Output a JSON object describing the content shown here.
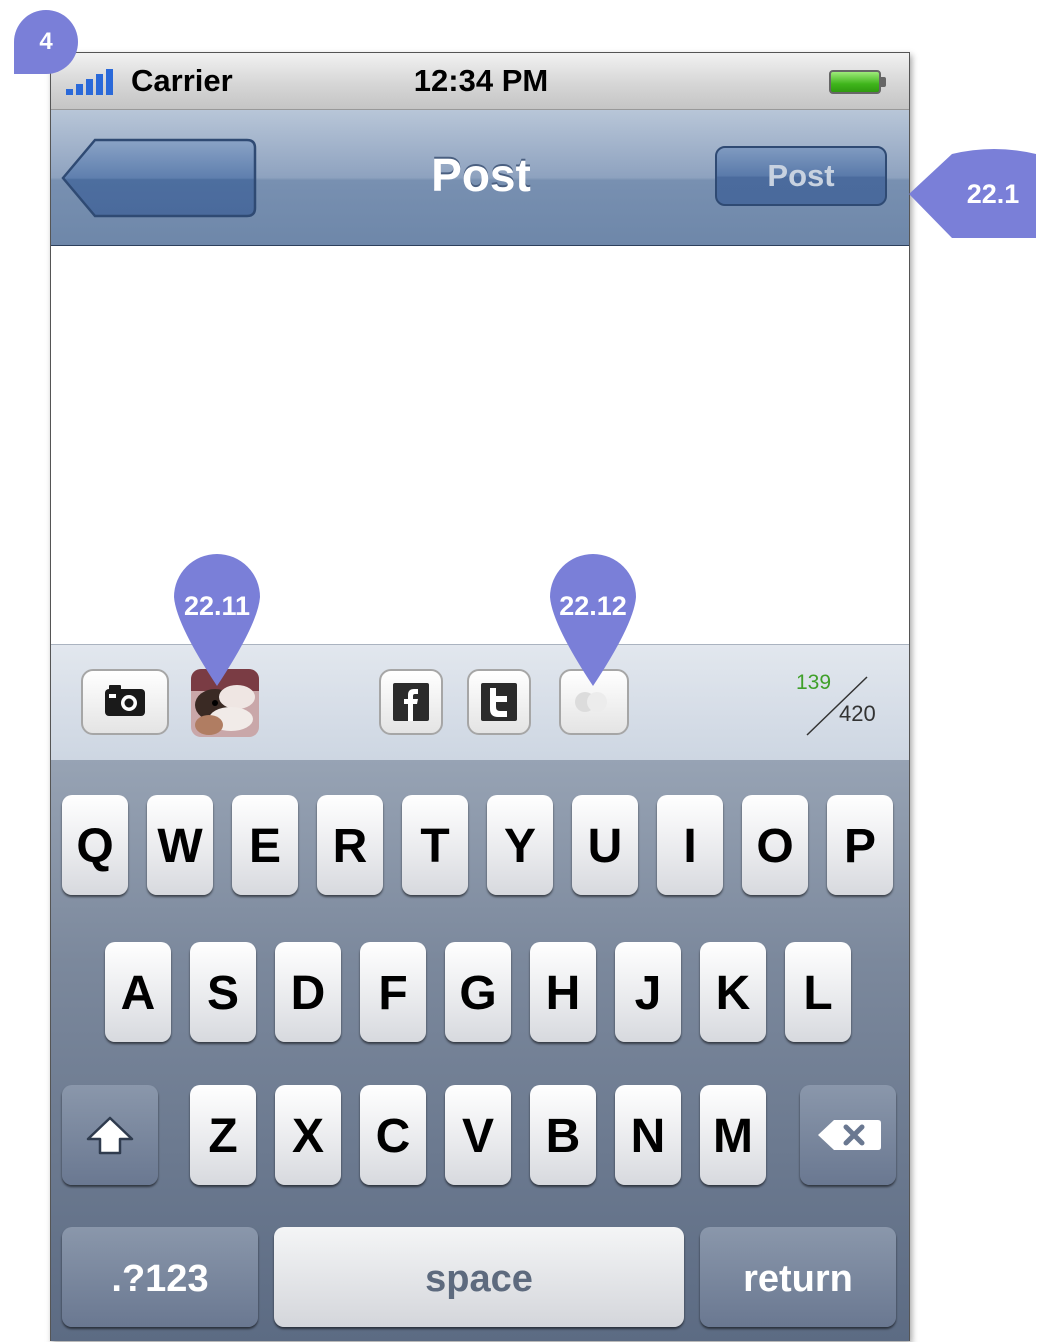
{
  "status_bar": {
    "carrier": "Carrier",
    "time": "12:34 PM"
  },
  "nav_bar": {
    "title": "Post",
    "post_button_label": "Post"
  },
  "toolbar": {
    "chars_used": "139",
    "chars_total": "420"
  },
  "keyboard": {
    "row1": [
      "Q",
      "W",
      "E",
      "R",
      "T",
      "Y",
      "U",
      "I",
      "O",
      "P"
    ],
    "row2": [
      "A",
      "S",
      "D",
      "F",
      "G",
      "H",
      "J",
      "K",
      "L"
    ],
    "row3": [
      "Z",
      "X",
      "C",
      "V",
      "B",
      "N",
      "M"
    ],
    "numbers_label": ".?123",
    "space_label": "space",
    "return_label": "return"
  },
  "annotations": {
    "screen_number": "4",
    "post_button": "22.1",
    "photo": "22.11",
    "toggle": "22.12"
  },
  "colors": {
    "annotation": "#7a7fd8",
    "nav_bar": "#7890b1",
    "signal": "#2a69d9",
    "battery": "#3fb51b",
    "count_used": "#3fa02a"
  },
  "icons": [
    "signal-bars-icon",
    "battery-icon",
    "back-arrow-icon",
    "camera-icon",
    "facebook-icon",
    "twitter-icon",
    "toggle-icon",
    "shift-icon",
    "backspace-icon"
  ]
}
